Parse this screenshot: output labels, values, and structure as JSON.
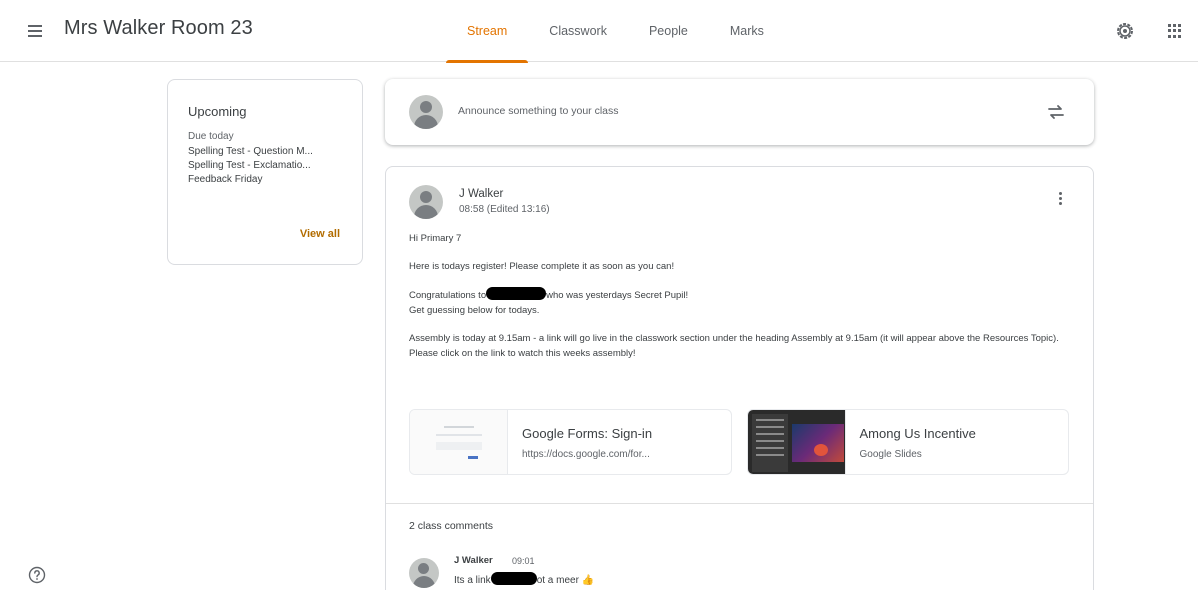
{
  "header": {
    "class_title": "Mrs Walker Room 23",
    "tabs": [
      {
        "label": "Stream",
        "active": true
      },
      {
        "label": "Classwork",
        "active": false
      },
      {
        "label": "People",
        "active": false
      },
      {
        "label": "Marks",
        "active": false
      }
    ],
    "icons": [
      "menu-icon",
      "settings-icon",
      "apps-icon"
    ]
  },
  "upcoming": {
    "title": "Upcoming",
    "subtitle": "Due today",
    "items": [
      "Spelling Test - Question M...",
      "Spelling Test - Exclamatio...",
      "Feedback Friday"
    ],
    "view_all": "View all"
  },
  "announce": {
    "placeholder": "Announce something to your class"
  },
  "post": {
    "author": "J Walker",
    "time": "08:58 (Edited 13:16)",
    "greeting": "Hi Primary 7",
    "line1": "Here is todays register! Please complete it as soon as you can!",
    "line2a": "Congratulations to",
    "line2b": "who was yesterdays Secret Pupil!",
    "line3": "Get guessing below for todays.",
    "line4": "Assembly is today at 9.15am - a link will go live in the classwork section under the heading Assembly at 9.15am (it will appear above the Resources Topic). Please click on the link to watch this weeks assembly!",
    "attachments": [
      {
        "title": "Google Forms: Sign-in",
        "subtitle": "https://docs.google.com/for..."
      },
      {
        "title": "Among Us Incentive",
        "subtitle": "Google Slides"
      }
    ]
  },
  "comments": {
    "count_label": "2 class comments",
    "items": [
      {
        "author": "J Walker",
        "time": "09:01",
        "text_a": "Its a link",
        "text_b": "ot a meer 👍"
      }
    ]
  },
  "colors": {
    "accent": "#e37400",
    "view_all": "#b26c00"
  }
}
